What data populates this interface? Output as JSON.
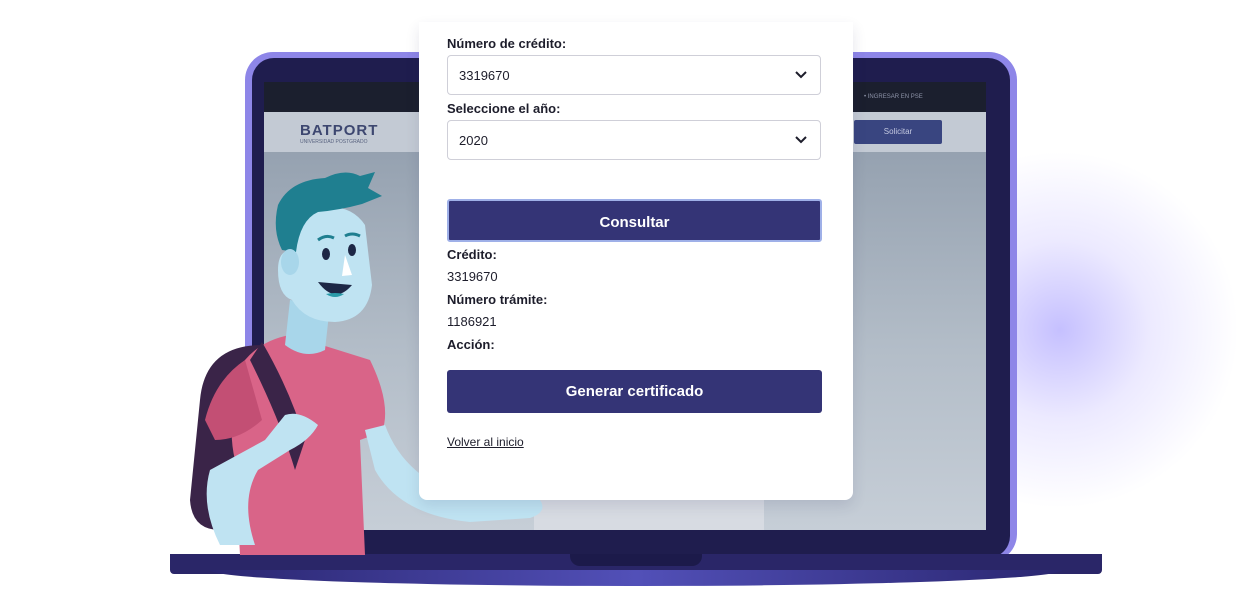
{
  "background_screen": {
    "logo": "BATPORT",
    "logo_sub": "UNIVERSIDAD POSTGRADO",
    "header_button": "Solicitar",
    "nav_text": "• INGRESAR EN PSE"
  },
  "form": {
    "credit_number_label": "Número de crédito:",
    "credit_number_value": "3319670",
    "year_label": "Seleccione el año:",
    "year_value": "2020",
    "consult_button": "Consultar",
    "generate_button": "Generar certificado",
    "back_link": "Volver al inicio"
  },
  "result": {
    "credit_label": "Crédito:",
    "credit_value": "3319670",
    "procedure_label": "Número trámite:",
    "procedure_value": "1186921",
    "action_label": "Acción:"
  },
  "colors": {
    "primary_button": "#343476",
    "laptop_frame": "#8e86e8",
    "laptop_bezel": "#1f1d4e",
    "shirt": "#d96488",
    "skin": "#bfe3f2",
    "hair": "#1f7f90",
    "backpack": "#3a2448"
  }
}
